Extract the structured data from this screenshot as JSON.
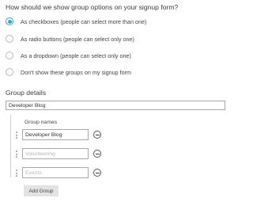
{
  "question": "How should we show group options on your signup form?",
  "options": [
    {
      "label": "As checkboxes (people can select more than one)",
      "checked": true
    },
    {
      "label": "As radio buttons (people can select only one)",
      "checked": false
    },
    {
      "label": "As a dropdown (people can select only one)",
      "checked": false
    },
    {
      "label": "Don't show these groups on my signup form",
      "checked": false
    }
  ],
  "group_details": {
    "title": "Group details",
    "group_title_value": "Developer Blog",
    "names_header": "Group names",
    "names": [
      {
        "value": "Developer Blog",
        "placeholder": ""
      },
      {
        "value": "",
        "placeholder": "Volunteering"
      },
      {
        "value": "",
        "placeholder": "Events"
      }
    ],
    "add_button": "Add Group"
  },
  "colors": {
    "accent": "#36a2d0",
    "border": "#a9a9a9",
    "button_bg": "#e3e3e3"
  },
  "icons": {
    "remove": "minus-circle-icon",
    "drag": "drag-handle-icon"
  }
}
